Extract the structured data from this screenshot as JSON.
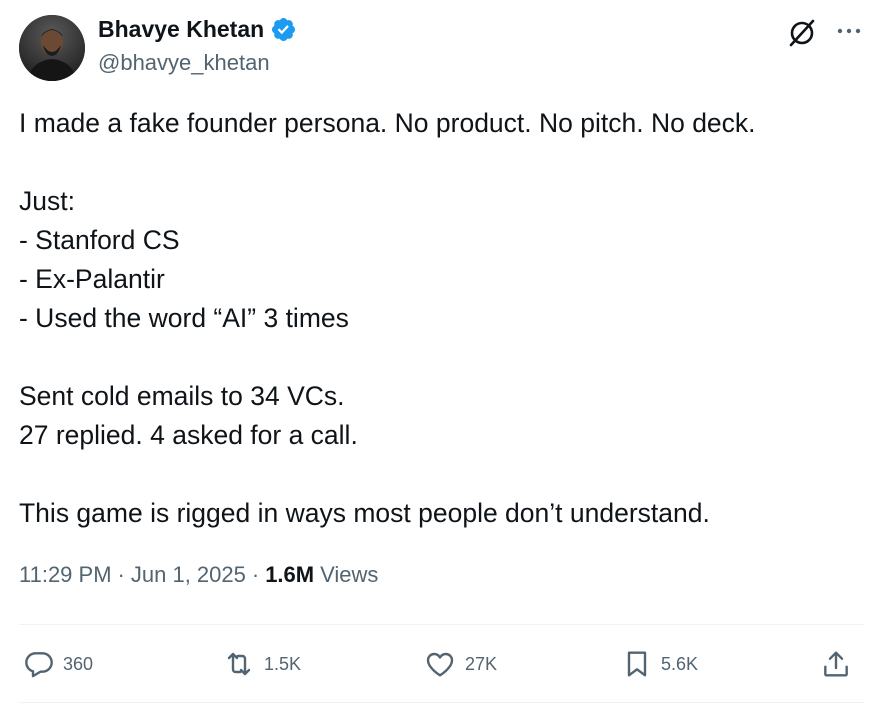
{
  "author": {
    "name": "Bhavye Khetan",
    "handle": "@bhavye_khetan",
    "verified": true,
    "verified_color": "#1d9bf0"
  },
  "tweet": {
    "lines": [
      "I made a fake founder persona. No product. No pitch. No deck.",
      "",
      "Just:",
      "- Stanford CS",
      "- Ex-Palantir",
      "- Used the word “AI” 3 times",
      "",
      "Sent cold emails to 34 VCs.",
      "27 replied. 4 asked for a call.",
      "",
      "This game is rigged in ways most people don’t understand."
    ]
  },
  "meta": {
    "time": "11:29 PM",
    "separator": "·",
    "date": "Jun 1, 2025",
    "views_count": "1.6M",
    "views_label": "Views"
  },
  "actions": {
    "replies": "360",
    "reposts": "1.5K",
    "likes": "27K",
    "bookmarks": "5.6K"
  },
  "icons": {
    "grok": "grok-icon",
    "more": "more-icon",
    "reply": "reply-icon",
    "repost": "repost-icon",
    "like": "heart-icon",
    "bookmark": "bookmark-icon",
    "share": "share-icon"
  },
  "colors": {
    "text": "#0f1419",
    "secondary": "#536471",
    "divider": "#eff3f4"
  }
}
